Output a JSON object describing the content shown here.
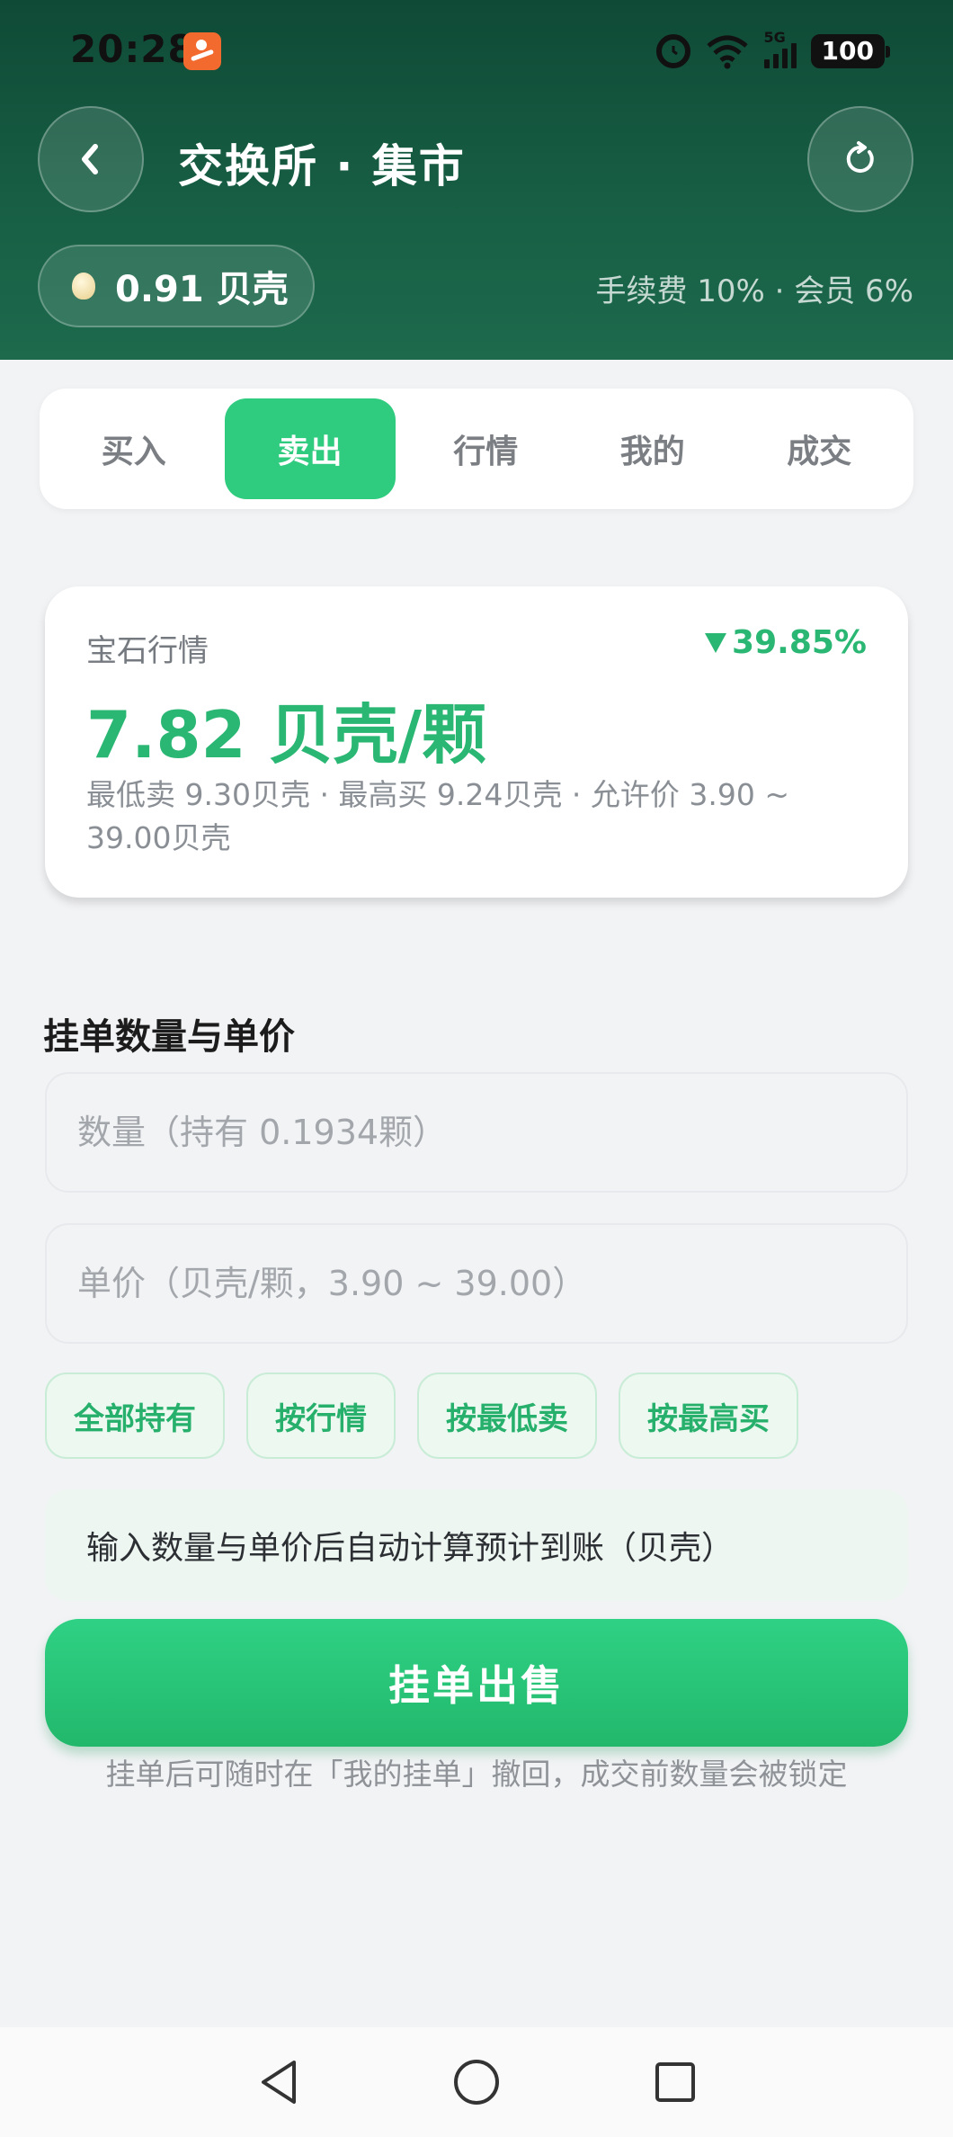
{
  "status_bar": {
    "time": "20:28",
    "network_label": "5G",
    "battery": "100"
  },
  "header": {
    "title": "交换所 · 集市",
    "balance": "0.91 贝壳",
    "fee_info": "手续费 10% · 会员 6%"
  },
  "tabs": [
    {
      "label": "买入",
      "active": false
    },
    {
      "label": "卖出",
      "active": true
    },
    {
      "label": "行情",
      "active": false
    },
    {
      "label": "我的",
      "active": false
    },
    {
      "label": "成交",
      "active": false
    }
  ],
  "market": {
    "label": "宝石行情",
    "change": "39.85%",
    "change_direction": "down",
    "price": "7.82 贝壳/颗",
    "detail": "最低卖 9.30贝壳 · 最高买 9.24贝壳 · 允许价 3.90 ~ 39.00贝壳"
  },
  "form": {
    "section_title": "挂单数量与单价",
    "quantity_placeholder": "数量（持有 0.1934颗）",
    "price_placeholder": "单价（贝壳/颗，3.90 ~ 39.00）",
    "quick_buttons": [
      "全部持有",
      "按行情",
      "按最低卖",
      "按最高买"
    ],
    "estimate_text": "输入数量与单价后自动计算预计到账（贝壳）",
    "submit_label": "挂单出售",
    "hint": "挂单后可随时在「我的挂单」撤回，成交前数量会被锁定"
  },
  "colors": {
    "header_dark": "#0f4a36",
    "accent_green": "#2fcb7f",
    "price_green": "#2ab673",
    "background": "#f2f3f5"
  },
  "icons": [
    "back-icon",
    "refresh-icon",
    "shell-icon",
    "alarm-icon",
    "wifi-icon",
    "signal-icon",
    "battery-icon",
    "nav-back-icon",
    "nav-home-icon",
    "nav-recent-icon"
  ]
}
